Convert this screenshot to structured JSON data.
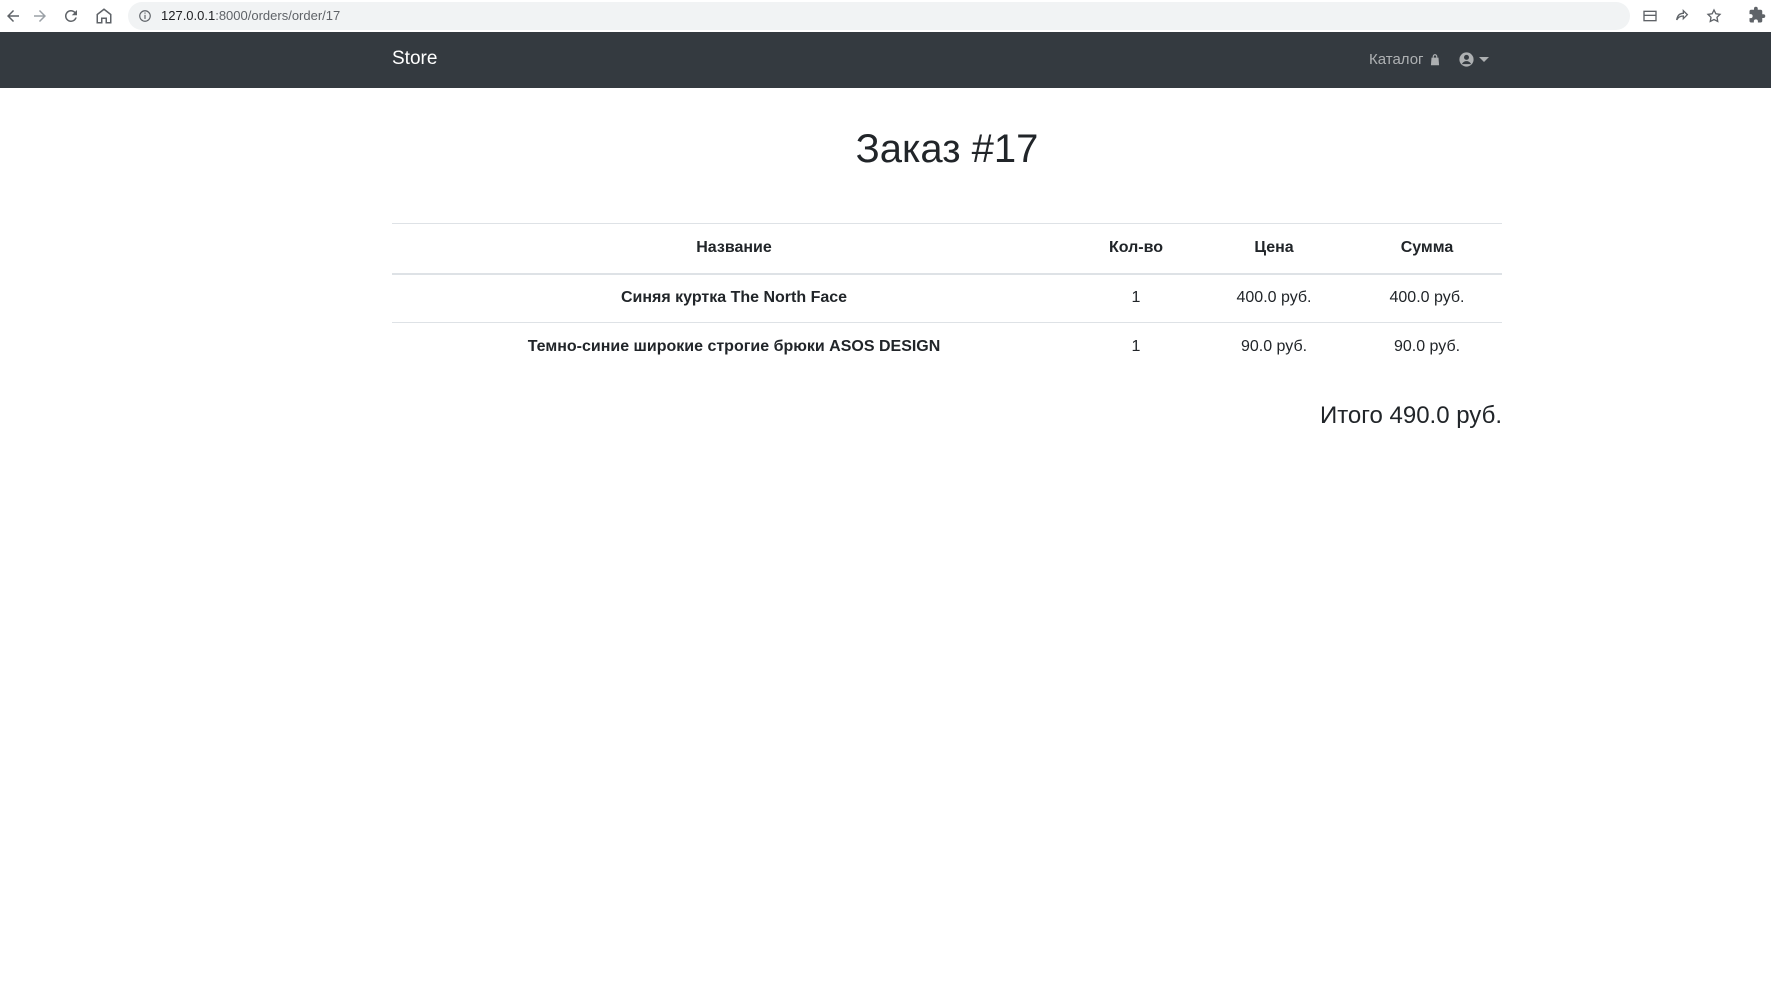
{
  "browser": {
    "url_host": "127.0.0.1",
    "url_path": ":8000/orders/order/17"
  },
  "navbar": {
    "brand": "Store",
    "catalog_label": "Каталог"
  },
  "page": {
    "title": "Заказ #17"
  },
  "table": {
    "headers": [
      "Название",
      "Кол-во",
      "Цена",
      "Сумма"
    ],
    "rows": [
      {
        "name": "Синяя куртка The North Face",
        "qty": "1",
        "price": "400.0 руб.",
        "sum": "400.0 руб."
      },
      {
        "name": "Темно-синие широкие строгие брюки ASOS DESIGN",
        "qty": "1",
        "price": "90.0 руб.",
        "sum": "90.0 руб."
      }
    ]
  },
  "total": "Итого 490.0 руб."
}
